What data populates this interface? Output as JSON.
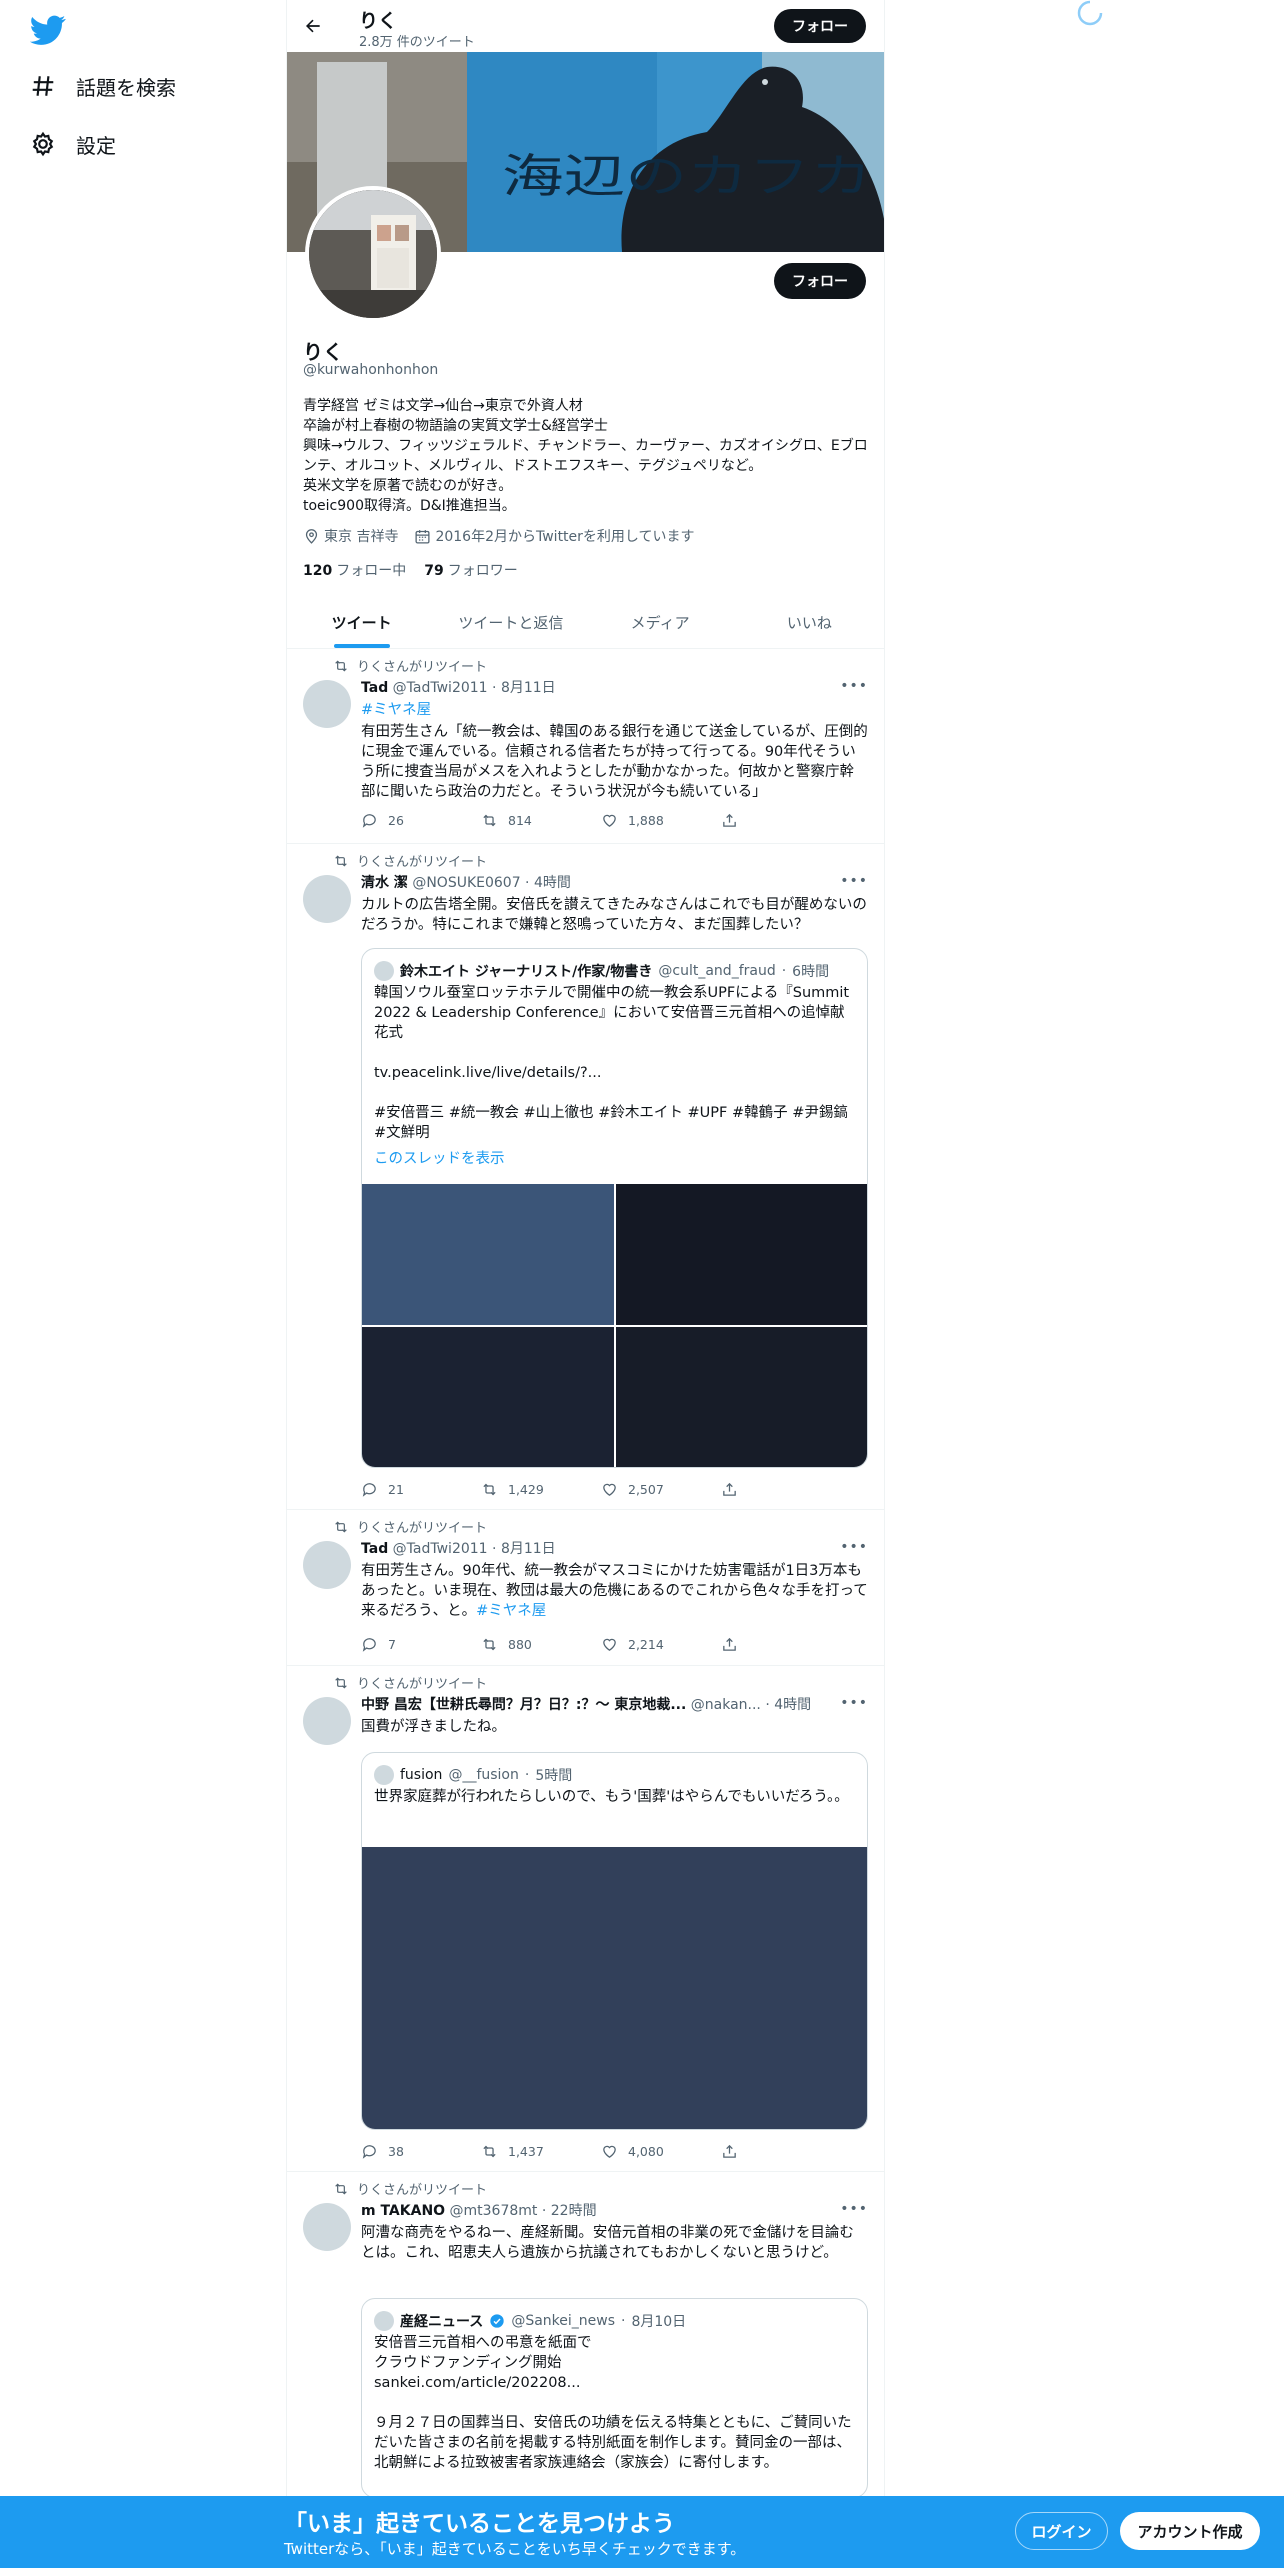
{
  "nav": {
    "explore_label": "話題を検索",
    "settings_label": "設定"
  },
  "colors": {
    "brand": "#1d9bf0",
    "text": "#0f1419",
    "muted": "#536471"
  },
  "header": {
    "name": "りく",
    "tweet_count": "2.8万 件のツイート",
    "follow_label": "フォロー"
  },
  "banner": {
    "text": "海辺のカフカ"
  },
  "profile": {
    "name": "りく",
    "handle": "@kurwahonhonhon",
    "follow_label": "フォロー",
    "bio": "青学経営 ゼミは文学→仙台→東京で外資人材\n卒論が村上春樹の物語論の実質文学士&経営学士\n興味→ウルフ、フィッツジェラルド、チャンドラー、カーヴァー、カズオイシグロ、Eブロンテ、オルコット、メルヴィル、ドストエフスキー、テグジュペリなど。\n英米文学を原著で読むのが好き。\ntoeic900取得済。D&I推進担当。",
    "location": "東京 吉祥寺",
    "joined": "2016年2月からTwitterを利用しています",
    "following_count": "120",
    "following_label": "フォロー中",
    "followers_count": "79",
    "followers_label": "フォロワー"
  },
  "tabs": [
    "ツイート",
    "ツイートと返信",
    "メディア",
    "いいね"
  ],
  "retweet_label": "りくさんがリツイート",
  "tweets": [
    {
      "name": "Tad",
      "handle": "@TadTwi2011",
      "time": "8月11日",
      "hashtag": "#ミヤネ屋",
      "text": "有田芳生さん「統一教会は、韓国のある銀行を通じて送金しているが、圧倒的に現金で運んでいる。信頼される信者たちが持って行ってる。90年代そういう所に捜査当局がメスを入れようとしたが動かなかった。何故かと警察庁幹部に聞いたら政治の力だと。そういう状況が今も続いている」",
      "replies": "26",
      "retweets": "814",
      "likes": "1,888"
    },
    {
      "name": "清水 潔",
      "handle": "@NOSUKE0607",
      "time": "4時間",
      "text": "カルトの広告塔全開。安倍氏を讃えてきたみなさんはこれでも目が醒めないのだろうか。特にこれまで嫌韓と怒鳴っていた方々、まだ国葬したい？",
      "quote": {
        "name": "鈴木エイト ジャーナリスト/作家/物書き",
        "handle": "@cult_and_fraud",
        "time": "6時間",
        "text": "韓国ソウル蚕室ロッテホテルで開催中の統一教会系UPFによる『Summit 2022 & Leadership Conference』において安倍晋三元首相への追悼献花式\n\ntv.peacelink.live/live/details/?...\n\n#安倍晋三 #統一教会 #山上徹也 #鈴木エイト #UPF #韓鶴子 #尹錫鎬 #文鮮明",
        "thread_label": "このスレッドを表示"
      },
      "replies": "21",
      "retweets": "1,429",
      "likes": "2,507"
    },
    {
      "name": "Tad",
      "handle": "@TadTwi2011",
      "time": "8月11日",
      "text": "有田芳生さん。90年代、統一教会がマスコミにかけた妨害電話が1日3万本もあったと。いま現在、教団は最大の危機にあるのでこれから色々な手を打って来るだろう、と。",
      "hashtag": "#ミヤネ屋",
      "replies": "7",
      "retweets": "880",
      "likes": "2,214"
    },
    {
      "name": "中野 昌宏【世耕氏尋問？月？日？:？〜 東京地裁...",
      "handle": "@nakan...",
      "time": "4時間",
      "text": "国費が浮きましたね。",
      "quote": {
        "name": "fusion",
        "handle": "@__fusion",
        "time": "5時間",
        "text": "世界家庭葬が行われたらしいので、もう'国葬'はやらんでもいいだろう。。"
      },
      "replies": "38",
      "retweets": "1,437",
      "likes": "4,080"
    },
    {
      "name": "m TAKANO",
      "handle": "@mt3678mt",
      "time": "22時間",
      "text": "阿漕な商売をやるねー、産経新聞。安倍元首相の非業の死で金儲けを目論むとは。これ、昭恵夫人ら遺族から抗議されてもおかしくないと思うけど。",
      "quote": {
        "name": "産経ニュース",
        "handle": "@Sankei_news",
        "time": "8月10日",
        "text": "安倍晋三元首相への弔意を紙面で\nクラウドファンディング開始\nsankei.com/article/202208...\n\n９月２７日の国葬当日、安倍氏の功績を伝える特集とともに、ご賛同いただいた皆さまの名前を掲載する特別紙面を制作します。賛同金の一部は、北朝鮮による拉致被害者家族連絡会（家族会）に寄付します。"
      }
    }
  ],
  "bottom_bar": {
    "title": "「いま」起きていることを見つけよう",
    "subtitle": "Twitterなら、「いま」起きていることをいち早くチェックできます。",
    "login_label": "ログイン",
    "signup_label": "アカウント作成"
  }
}
